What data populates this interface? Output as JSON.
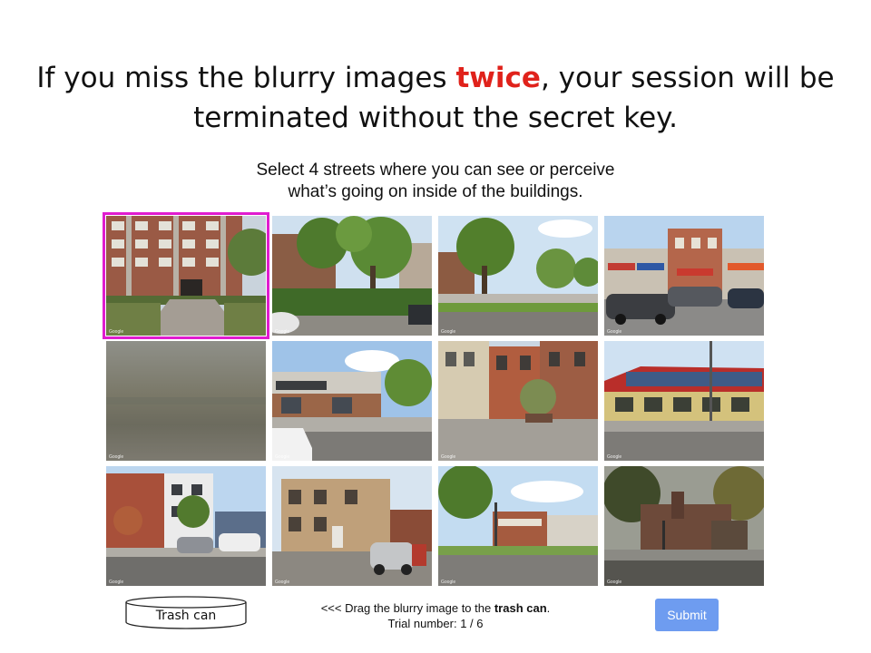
{
  "warning": {
    "part1": "If you miss the blurry images ",
    "emphasis": "twice",
    "part2": ", your session will be terminated without the secret key."
  },
  "instruction": {
    "line1": "Select 4 streets where you can see or perceive",
    "line2": "what’s going on inside of the buildings."
  },
  "grid": {
    "credit": "Google",
    "selected_index": 0,
    "tiles": [
      {
        "id": "brick-apartment-driveway"
      },
      {
        "id": "tree-lined-residential"
      },
      {
        "id": "trees-parkway-lawn"
      },
      {
        "id": "storefront-parked-cars"
      },
      {
        "id": "blurry-image"
      },
      {
        "id": "development-building-corner"
      },
      {
        "id": "rowhouses-plaza"
      },
      {
        "id": "red-roof-restaurant"
      },
      {
        "id": "modern-apartments-street"
      },
      {
        "id": "alley-brick-building"
      },
      {
        "id": "corner-shop-street"
      },
      {
        "id": "dark-street-lamp"
      }
    ]
  },
  "trash": {
    "label": "Trash can"
  },
  "hint": {
    "prefix": "<<< Drag the blurry image to the ",
    "bold": "trash can",
    "suffix": ".",
    "trial_label": "Trial number: 1 / 6"
  },
  "submit": {
    "label": "Submit"
  },
  "colors": {
    "emphasis": "#e0221b",
    "selection_outline": "#e01ccf",
    "submit_bg": "#6e9cf0"
  }
}
